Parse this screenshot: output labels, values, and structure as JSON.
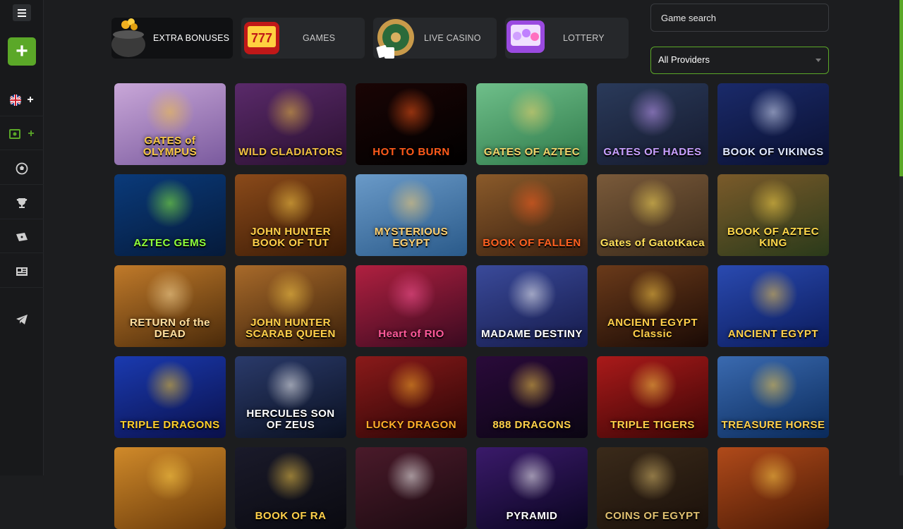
{
  "sidebar": {
    "menu_icon": "hamburger-icon",
    "add_label": "+",
    "items": [
      {
        "icon": "uk-flag-icon",
        "plus": "+"
      },
      {
        "icon": "cash-icon",
        "plus": "+"
      },
      {
        "icon": "soccer-ball-icon",
        "plus": ""
      },
      {
        "icon": "trophy-icon",
        "plus": ""
      },
      {
        "icon": "ticket-icon",
        "plus": ""
      },
      {
        "icon": "news-icon",
        "plus": ""
      },
      {
        "icon": "telegram-icon",
        "plus": ""
      }
    ]
  },
  "tabs": [
    {
      "label": "EXTRA BONUSES",
      "active": true
    },
    {
      "label": "GAMES",
      "active": false
    },
    {
      "label": "LIVE CASINO",
      "active": false
    },
    {
      "label": "LOTTERY",
      "active": false
    }
  ],
  "search": {
    "placeholder": "Game search"
  },
  "providers": {
    "selected": "All Providers"
  },
  "games": [
    {
      "title": "GATES of OLYMPUS",
      "bg": "#c9a7d8",
      "bg2": "#7a5a9e",
      "text": "#f5c542"
    },
    {
      "title": "WILD GLADIATORS",
      "bg": "#5a2a6a",
      "bg2": "#2a1030",
      "text": "#f0c040"
    },
    {
      "title": "HOT TO BURN",
      "bg": "#1a0505",
      "bg2": "#000000",
      "text": "#ff5a1a"
    },
    {
      "title": "GATES OF AZTEC",
      "bg": "#6fbf8a",
      "bg2": "#2f7a4a",
      "text": "#f2d36a"
    },
    {
      "title": "GATES OF HADES",
      "bg": "#2a3a5a",
      "bg2": "#151a2e",
      "text": "#c9a0ff"
    },
    {
      "title": "BOOK OF VIKINGS",
      "bg": "#1a2a6a",
      "bg2": "#0a1030",
      "text": "#e0e8ff"
    },
    {
      "title": "AZTEC GEMS",
      "bg": "#0a3a7a",
      "bg2": "#051a3a",
      "text": "#8fff3a"
    },
    {
      "title": "JOHN HUNTER BOOK OF TUT",
      "bg": "#8a4a1a",
      "bg2": "#3a1a05",
      "text": "#ffd04a"
    },
    {
      "title": "MYSTERIOUS EGYPT",
      "bg": "#6a9ac8",
      "bg2": "#2a5a8a",
      "text": "#ffd070"
    },
    {
      "title": "BOOK OF FALLEN",
      "bg": "#8a5a2a",
      "bg2": "#3a2010",
      "text": "#ff6020"
    },
    {
      "title": "Gates of GatotKaca",
      "bg": "#7a5a3a",
      "bg2": "#3a2a1a",
      "text": "#ffe05a"
    },
    {
      "title": "BOOK OF AZTEC KING",
      "bg": "#7a5a2a",
      "bg2": "#2a3a1a",
      "text": "#ffd84a"
    },
    {
      "title": "RETURN of the DEAD",
      "bg": "#c07a2a",
      "bg2": "#4a2a0a",
      "text": "#ffe0a0"
    },
    {
      "title": "JOHN HUNTER SCARAB QUEEN",
      "bg": "#a86a2a",
      "bg2": "#3a200a",
      "text": "#ffd04a"
    },
    {
      "title": "Heart of RIO",
      "bg": "#b02040",
      "bg2": "#3a0a20",
      "text": "#ff5a9a"
    },
    {
      "title": "MADAME DESTINY",
      "bg": "#3a4a9a",
      "bg2": "#151a4a",
      "text": "#ffffff"
    },
    {
      "title": "ANCIENT EGYPT Classic",
      "bg": "#6a3a1a",
      "bg2": "#1a0a05",
      "text": "#ffcf4a"
    },
    {
      "title": "ANCIENT EGYPT",
      "bg": "#2a4ab0",
      "bg2": "#0a1a5a",
      "text": "#ffd04a"
    },
    {
      "title": "TRIPLE DRAGONS",
      "bg": "#1a3ab0",
      "bg2": "#0a104a",
      "text": "#ffcf2a"
    },
    {
      "title": "HERCULES SON OF ZEUS",
      "bg": "#2a3a6a",
      "bg2": "#0a1020",
      "text": "#ffffff"
    },
    {
      "title": "LUCKY DRAGON",
      "bg": "#8a1a1a",
      "bg2": "#2a0505",
      "text": "#ffb02a"
    },
    {
      "title": "888 DRAGONS",
      "bg": "#2a0a3a",
      "bg2": "#0a0512",
      "text": "#ffd04a"
    },
    {
      "title": "TRIPLE TIGERS",
      "bg": "#aa1a1a",
      "bg2": "#3a0505",
      "text": "#ffd04a"
    },
    {
      "title": "TREASURE HORSE",
      "bg": "#3a6ab0",
      "bg2": "#0a2a5a",
      "text": "#ffcf4a"
    },
    {
      "title": "",
      "bg": "#d08a2a",
      "bg2": "#6a3a0a",
      "text": "#ffd04a"
    },
    {
      "title": "BOOK OF RA",
      "bg": "#1a1a2a",
      "bg2": "#0a0a10",
      "text": "#ffd04a"
    },
    {
      "title": "",
      "bg": "#4a1a2a",
      "bg2": "#1a0a10",
      "text": "#ffffff"
    },
    {
      "title": "PYRAMID",
      "bg": "#3a1a6a",
      "bg2": "#0a0520",
      "text": "#ffffff"
    },
    {
      "title": "COINS OF EGYPT",
      "bg": "#3a2a1a",
      "bg2": "#1a100a",
      "text": "#e0c070"
    },
    {
      "title": "",
      "bg": "#b04a1a",
      "bg2": "#4a1a05",
      "text": "#ffd04a"
    }
  ],
  "colors": {
    "accent": "#5ba828",
    "bg": "#1c1d1f",
    "panel": "#26282b"
  }
}
